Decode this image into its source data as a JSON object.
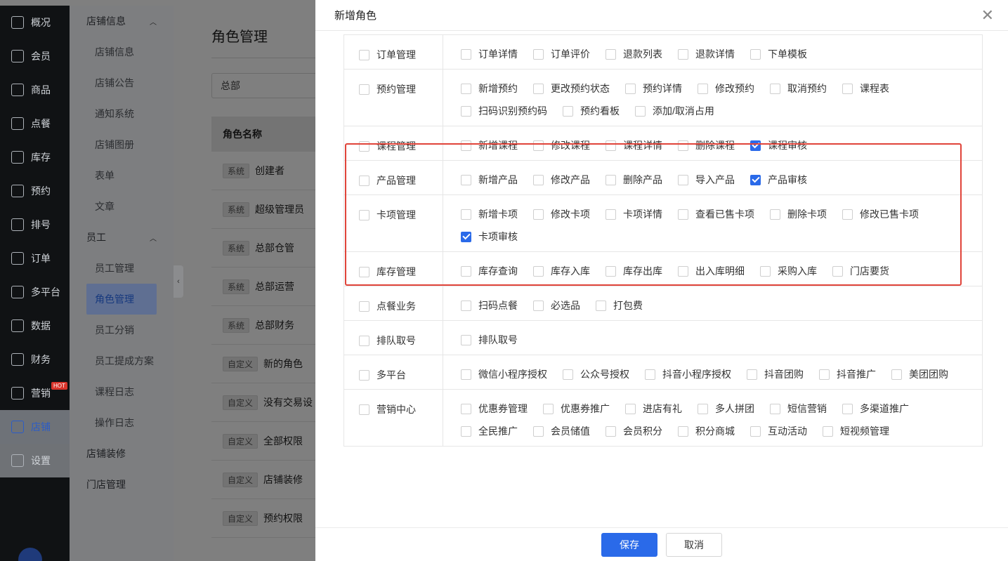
{
  "nav": {
    "items": [
      {
        "label": "概况",
        "icon": "grid-icon"
      },
      {
        "label": "会员",
        "icon": "crown-icon"
      },
      {
        "label": "商品",
        "icon": "store-icon"
      },
      {
        "label": "点餐",
        "icon": "dish-icon"
      },
      {
        "label": "库存",
        "icon": "inventory-icon"
      },
      {
        "label": "预约",
        "icon": "calendar-check-icon"
      },
      {
        "label": "排号",
        "icon": "queue-icon"
      },
      {
        "label": "订单",
        "icon": "order-icon"
      },
      {
        "label": "多平台",
        "icon": "layers-icon"
      },
      {
        "label": "数据",
        "icon": "chart-icon"
      },
      {
        "label": "财务",
        "icon": "yen-icon"
      },
      {
        "label": "营销",
        "icon": "marketing-icon",
        "badge": "HOT"
      },
      {
        "label": "店铺",
        "icon": "shop-icon"
      },
      {
        "label": "设置",
        "icon": "settings-icon"
      }
    ]
  },
  "subnav": {
    "group1": "店铺信息",
    "group1_items": [
      "店铺信息",
      "店铺公告",
      "通知系统",
      "店铺图册",
      "表单",
      "文章"
    ],
    "group2": "员工",
    "group2_items": [
      "员工管理",
      "角色管理",
      "员工分销",
      "员工提成方案",
      "课程日志",
      "操作日志"
    ],
    "group3": "店铺装修",
    "group4": "门店管理"
  },
  "background": {
    "title": "角色管理",
    "select_value": "总部",
    "column_header": "角色名称",
    "rows": [
      {
        "tag": "系统",
        "name": "创建者"
      },
      {
        "tag": "系统",
        "name": "超级管理员"
      },
      {
        "tag": "系统",
        "name": "总部仓管"
      },
      {
        "tag": "系统",
        "name": "总部运营"
      },
      {
        "tag": "系统",
        "name": "总部财务"
      },
      {
        "tag": "自定义",
        "name": "新的角色"
      },
      {
        "tag": "自定义",
        "name": "没有交易设"
      },
      {
        "tag": "自定义",
        "name": "全部权限"
      },
      {
        "tag": "自定义",
        "name": "店铺装修"
      },
      {
        "tag": "自定义",
        "name": "预约权限"
      }
    ]
  },
  "drawer": {
    "title": "新增角色",
    "modules": [
      {
        "label": "订单管理",
        "options": [
          [
            "订单详情",
            false
          ],
          [
            "订单评价",
            false
          ],
          [
            "退款列表",
            false
          ],
          [
            "退款详情",
            false
          ],
          [
            "下单模板",
            false
          ]
        ]
      },
      {
        "label": "预约管理",
        "options": [
          [
            "新增预约",
            false
          ],
          [
            "更改预约状态",
            false
          ],
          [
            "预约详情",
            false
          ],
          [
            "修改预约",
            false
          ],
          [
            "取消预约",
            false
          ],
          [
            "课程表",
            false
          ],
          [
            "扫码识别预约码",
            false
          ],
          [
            "预约看板",
            false
          ],
          [
            "添加/取消占用",
            false
          ]
        ]
      },
      {
        "label": "课程管理",
        "options": [
          [
            "新增课程",
            false
          ],
          [
            "修改课程",
            false
          ],
          [
            "课程详情",
            false
          ],
          [
            "删除课程",
            false
          ],
          [
            "课程审核",
            true
          ]
        ]
      },
      {
        "label": "产品管理",
        "options": [
          [
            "新增产品",
            false
          ],
          [
            "修改产品",
            false
          ],
          [
            "删除产品",
            false
          ],
          [
            "导入产品",
            false
          ],
          [
            "产品审核",
            true
          ]
        ]
      },
      {
        "label": "卡项管理",
        "options": [
          [
            "新增卡项",
            false
          ],
          [
            "修改卡项",
            false
          ],
          [
            "卡项详情",
            false
          ],
          [
            "查看已售卡项",
            false
          ],
          [
            "删除卡项",
            false
          ],
          [
            "修改已售卡项",
            false
          ],
          [
            "卡项审核",
            true
          ]
        ]
      },
      {
        "label": "库存管理",
        "options": [
          [
            "库存查询",
            false
          ],
          [
            "库存入库",
            false
          ],
          [
            "库存出库",
            false
          ],
          [
            "出入库明细",
            false
          ],
          [
            "采购入库",
            false
          ],
          [
            "门店要货",
            false
          ]
        ]
      },
      {
        "label": "点餐业务",
        "options": [
          [
            "扫码点餐",
            false
          ],
          [
            "必选品",
            false
          ],
          [
            "打包费",
            false
          ]
        ]
      },
      {
        "label": "排队取号",
        "options": [
          [
            "排队取号",
            false
          ]
        ]
      },
      {
        "label": "多平台",
        "options": [
          [
            "微信小程序授权",
            false
          ],
          [
            "公众号授权",
            false
          ],
          [
            "抖音小程序授权",
            false
          ],
          [
            "抖音团购",
            false
          ],
          [
            "抖音推广",
            false
          ],
          [
            "美团团购",
            false
          ]
        ]
      },
      {
        "label": "营销中心",
        "options": [
          [
            "优惠券管理",
            false
          ],
          [
            "优惠券推广",
            false
          ],
          [
            "进店有礼",
            false
          ],
          [
            "多人拼团",
            false
          ],
          [
            "短信营销",
            false
          ],
          [
            "多渠道推广",
            false
          ],
          [
            "全民推广",
            false
          ],
          [
            "会员储值",
            false
          ],
          [
            "会员积分",
            false
          ],
          [
            "积分商城",
            false
          ],
          [
            "互动活动",
            false
          ],
          [
            "短视频管理",
            false
          ]
        ]
      }
    ],
    "save_label": "保存",
    "cancel_label": "取消"
  }
}
